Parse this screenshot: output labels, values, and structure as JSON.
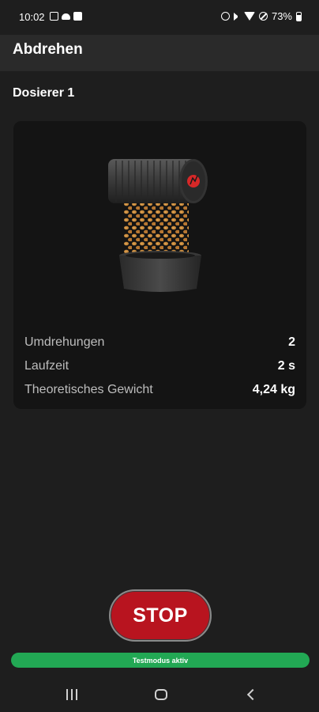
{
  "status_bar": {
    "time": "10:02",
    "battery": "73%",
    "left_icons": [
      "image-icon",
      "cloud-icon",
      "teams-icon"
    ],
    "right_icons": [
      "alarm-icon",
      "mute-icon",
      "wifi-icon",
      "dnd-icon",
      "battery-icon"
    ]
  },
  "app_bar": {
    "title": "Abdrehen"
  },
  "section": {
    "title": "Dosierer 1"
  },
  "card": {
    "illustration": "dosing-roller-icon",
    "rows": [
      {
        "label": "Umdrehungen",
        "value": "2"
      },
      {
        "label": "Laufzeit",
        "value": "2 s"
      },
      {
        "label": "Theoretisches Gewicht",
        "value": "4,24 kg"
      }
    ]
  },
  "actions": {
    "stop_label": "STOP"
  },
  "banner": {
    "text": "Testmodus aktiv"
  },
  "nav_bar": {
    "icons": [
      "recent-apps-icon",
      "home-icon",
      "back-icon"
    ]
  },
  "colors": {
    "background": "#1e1e1e",
    "app_bar": "#2a2a2a",
    "card": "#141414",
    "stop_button": "#b8141f",
    "banner": "#22a854",
    "accent_red": "#d62828"
  }
}
